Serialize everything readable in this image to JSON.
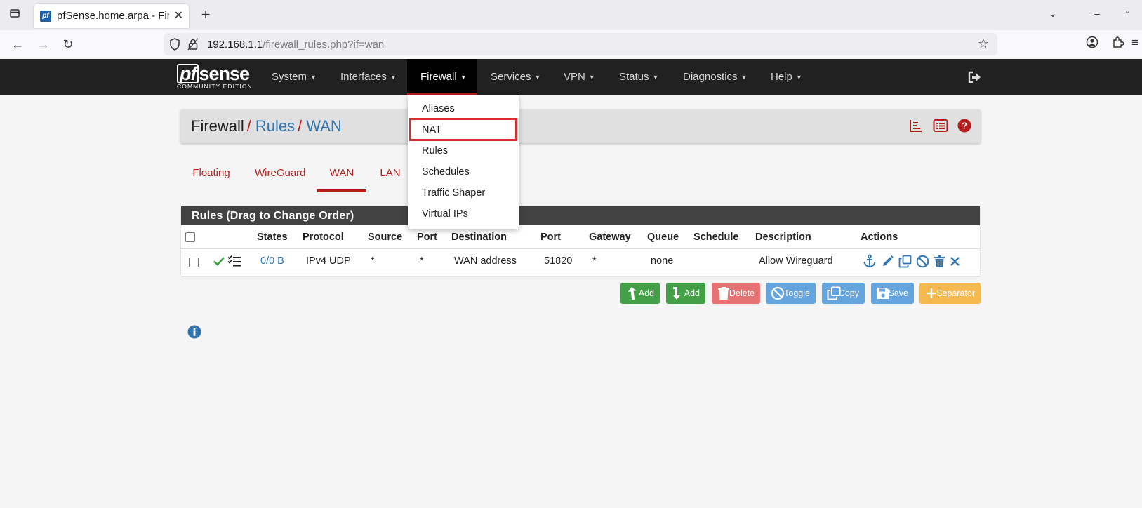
{
  "browser": {
    "tab_title": "pfSense.home.arpa - Firewall: Rules: WAN",
    "tab_favicon": "pf",
    "url_host": "192.168.1.1",
    "url_path": "/firewall_rules.php?if=wan"
  },
  "header": {
    "logo_text": "pfsense",
    "logo_box": "pf",
    "logo_rest": "sense",
    "logo_edition": "COMMUNITY EDITION",
    "menu": [
      "System",
      "Interfaces",
      "Firewall",
      "Services",
      "VPN",
      "Status",
      "Diagnostics",
      "Help"
    ],
    "active_menu": "Firewall"
  },
  "breadcrumb": {
    "root": "Firewall",
    "section": "Rules",
    "page": "WAN"
  },
  "interface_tabs": [
    "Floating",
    "WireGuard",
    "WAN",
    "LAN"
  ],
  "active_interface_tab": "WAN",
  "rules": {
    "panel_title": "Rules (Drag to Change Order)",
    "columns": [
      "States",
      "Protocol",
      "Source",
      "Port",
      "Destination",
      "Port",
      "Gateway",
      "Queue",
      "Schedule",
      "Description",
      "Actions"
    ],
    "rows": [
      {
        "states": "0/0 B",
        "protocol": "IPv4 UDP",
        "source": "*",
        "source_port": "*",
        "destination": "WAN address",
        "dest_port": "51820",
        "gateway": "*",
        "queue": "none",
        "schedule": "",
        "description": "Allow Wireguard"
      }
    ]
  },
  "buttons": {
    "add_top": "Add",
    "add_bottom": "Add",
    "delete": "Delete",
    "toggle": "Toggle",
    "copy": "Copy",
    "save": "Save",
    "separator": "Separator"
  },
  "firewall_menu": [
    "Aliases",
    "NAT",
    "Rules",
    "Schedules",
    "Traffic Shaper",
    "Virtual IPs"
  ],
  "highlighted_menu_item": "NAT",
  "colors": {
    "accent_red": "#b71c1c",
    "link_blue": "#3276b1",
    "header_bg": "#212121",
    "success_green": "#43a047"
  }
}
